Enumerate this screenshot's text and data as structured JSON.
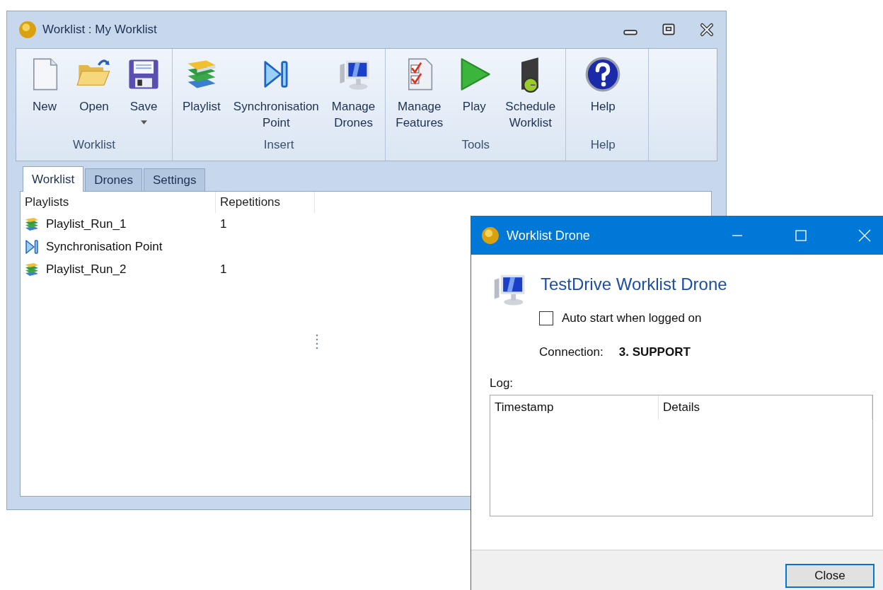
{
  "main_window": {
    "title": "Worklist : My Worklist",
    "ribbon": [
      {
        "name": "Worklist",
        "buttons": [
          {
            "label": "New",
            "kind": "new",
            "dropdown": false
          },
          {
            "label": "Open",
            "kind": "open",
            "dropdown": false
          },
          {
            "label": "Save",
            "kind": "save",
            "dropdown": true
          }
        ]
      },
      {
        "name": "Insert",
        "buttons": [
          {
            "label": "Playlist",
            "kind": "playlist",
            "dropdown": false
          },
          {
            "label": "Synchronisation Point",
            "kind": "sync",
            "dropdown": false
          },
          {
            "label": "Manage Drones",
            "kind": "drones",
            "dropdown": false
          }
        ]
      },
      {
        "name": "Tools",
        "buttons": [
          {
            "label": "Manage Features",
            "kind": "features",
            "dropdown": false
          },
          {
            "label": "Play",
            "kind": "play",
            "dropdown": false
          },
          {
            "label": "Schedule Worklist",
            "kind": "schedule",
            "dropdown": false
          }
        ]
      },
      {
        "name": "Help",
        "buttons": [
          {
            "label": "Help",
            "kind": "help",
            "dropdown": false
          }
        ]
      }
    ],
    "tabs": [
      {
        "label": "Worklist",
        "selected": true
      },
      {
        "label": "Drones",
        "selected": false
      },
      {
        "label": "Settings",
        "selected": false
      }
    ],
    "table": {
      "columns": [
        "Playlists",
        "Repetitions"
      ],
      "rows": [
        {
          "kind": "playlist",
          "name": "Playlist_Run_1",
          "repetitions": "1"
        },
        {
          "kind": "sync",
          "name": "Synchronisation Point"
        },
        {
          "kind": "playlist",
          "name": "Playlist_Run_2",
          "repetitions": "1"
        }
      ]
    }
  },
  "dialog": {
    "title": "Worklist Drone",
    "heading": "TestDrive Worklist Drone",
    "auto_start": {
      "label": "Auto start when logged on",
      "checked": false
    },
    "connection": {
      "label": "Connection:",
      "value": "3. SUPPORT"
    },
    "log": {
      "label": "Log:",
      "columns": [
        "Timestamp",
        "Details"
      ]
    },
    "buttons": [
      "Close"
    ]
  }
}
